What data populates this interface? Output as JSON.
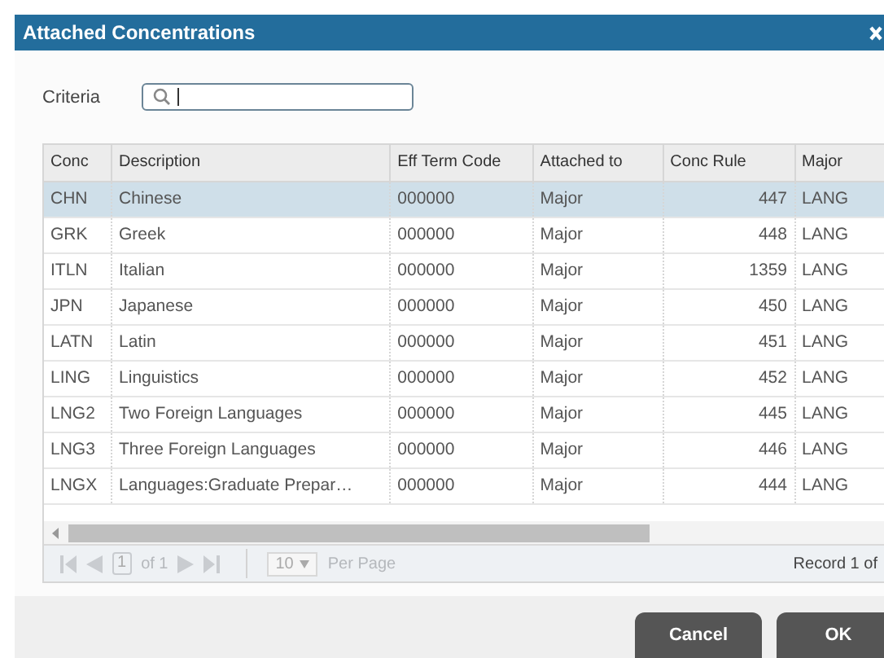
{
  "dialog": {
    "title": "Attached Concentrations"
  },
  "criteria": {
    "label": "Criteria"
  },
  "table": {
    "columns": [
      "Conc",
      "Description",
      "Eff Term Code",
      "Attached to",
      "Conc Rule",
      "Major"
    ],
    "rows": [
      {
        "cells": [
          "CHN",
          "Chinese",
          "000000",
          "Major",
          "447",
          "LANG"
        ],
        "selected": true
      },
      {
        "cells": [
          "GRK",
          "Greek",
          "000000",
          "Major",
          "448",
          "LANG"
        ],
        "selected": false
      },
      {
        "cells": [
          "ITLN",
          "Italian",
          "000000",
          "Major",
          "1359",
          "LANG"
        ],
        "selected": false
      },
      {
        "cells": [
          "JPN",
          "Japanese",
          "000000",
          "Major",
          "450",
          "LANG"
        ],
        "selected": false
      },
      {
        "cells": [
          "LATN",
          "Latin",
          "000000",
          "Major",
          "451",
          "LANG"
        ],
        "selected": false
      },
      {
        "cells": [
          "LING",
          "Linguistics",
          "000000",
          "Major",
          "452",
          "LANG"
        ],
        "selected": false
      },
      {
        "cells": [
          "LNG2",
          "Two Foreign Languages",
          "000000",
          "Major",
          "445",
          "LANG"
        ],
        "selected": false
      },
      {
        "cells": [
          "LNG3",
          "Three Foreign Languages",
          "000000",
          "Major",
          "446",
          "LANG"
        ],
        "selected": false
      },
      {
        "cells": [
          "LNGX",
          "Languages:Graduate Prepar…",
          "000000",
          "Major",
          "444",
          "LANG"
        ],
        "selected": false
      }
    ]
  },
  "pager": {
    "page": "1",
    "of": "of 1",
    "per_page_value": "10",
    "per_page_label": "Per Page",
    "record": "Record 1 of"
  },
  "buttons": [
    "Cancel",
    "OK"
  ]
}
